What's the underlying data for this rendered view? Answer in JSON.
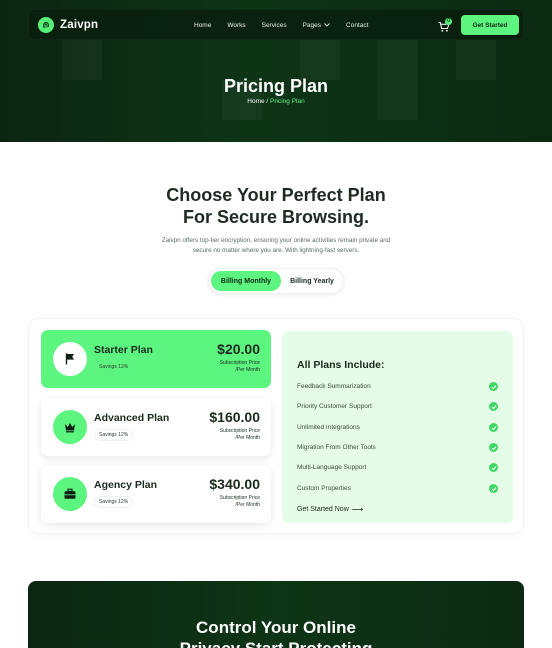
{
  "brand": {
    "name": "Zaivpn",
    "accent": "#5cf57f",
    "dark": "#0c2a12"
  },
  "nav": {
    "links": [
      "Home",
      "Works",
      "Services",
      "Pages",
      "Contact"
    ],
    "cart_count": "0",
    "cta_label": "Get Started"
  },
  "hero": {
    "title": "Pricing Plan",
    "breadcrumb_home": "Home",
    "breadcrumb_sep": " / ",
    "breadcrumb_current": "Pricing Plan"
  },
  "section": {
    "heading_line1": "Choose Your Perfect Plan",
    "heading_line2": "For Secure Browsing.",
    "description": "Zaivpn offers top-tier encryption, ensuring your online activities remain private and secure no matter where you are. With lightning-fast servers.",
    "billing_monthly": "Billing Monthly",
    "billing_yearly": "Billing Yearly"
  },
  "plans": [
    {
      "name": "Starter Plan",
      "savings": "Savings 12%",
      "price": "$20.00",
      "sub1": "Subscription Price",
      "sub2": "/Per Month",
      "icon": "flag-icon",
      "active": true
    },
    {
      "name": "Advanced Plan",
      "savings": "Savings 12%",
      "price": "$160.00",
      "sub1": "Subscription Price",
      "sub2": "/Per Month",
      "icon": "crown-icon",
      "active": false
    },
    {
      "name": "Agency Plan",
      "savings": "Savings 12%",
      "price": "$340.00",
      "sub1": "Subscription Price",
      "sub2": "/Per Month",
      "icon": "briefcase-icon",
      "active": false
    }
  ],
  "includes": {
    "title": "All Plans Include:",
    "features": [
      "Feedback Summarization",
      "Priority Customer Support",
      "Unlimited Integrations",
      "Migration From Other Tools",
      "Multi-Language Support",
      "Custom Properties"
    ],
    "cta": "Get Started Now",
    "cta_arrow": "⟶"
  },
  "banner": {
    "line1": "Control Your Online",
    "line2": "Privacy Start Protecting"
  }
}
